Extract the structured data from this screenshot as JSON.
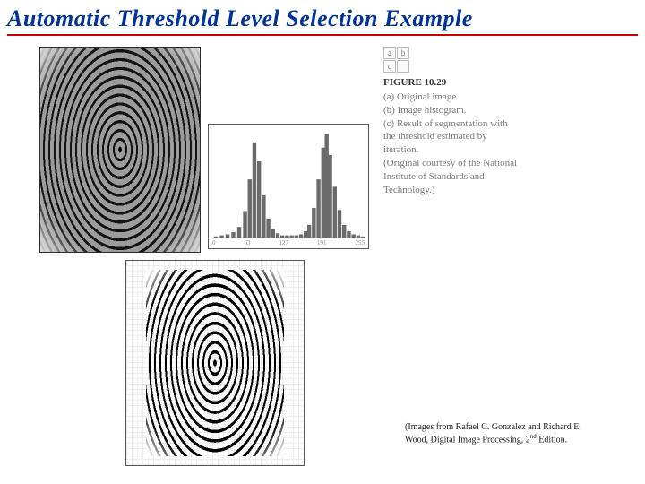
{
  "title": "Automatic Threshold Level Selection Example",
  "caption": {
    "grid": {
      "a": "a",
      "b": "b",
      "c": "c"
    },
    "figure_label": "FIGURE 10.29",
    "text_a": "(a) Original image.",
    "text_b": "(b) Image histogram.",
    "text_c": "(c) Result of segmentation with the threshold estimated by iteration.",
    "credit": "(Original courtesy of the National Institute of Standards and Technology.)"
  },
  "attribution": {
    "line1": "(Images from Rafael C. Gonzalez and Richard E.",
    "line2_pre": "Wood, Digital Image Processing, 2",
    "line2_sup": "nd",
    "line2_post": " Edition."
  },
  "chart_data": {
    "type": "bar",
    "title": "",
    "xlabel": "",
    "ylabel": "",
    "xlim": [
      0,
      255
    ],
    "ylim": [
      0,
      100
    ],
    "x_ticks": [
      0,
      63,
      127,
      191,
      255
    ],
    "description": "Bimodal grayscale image histogram with two prominent peaks (dark ridge pixels and light background pixels) separated by a deep valley around mid-gray, suitable for automatic threshold selection.",
    "series": [
      {
        "name": "histogram",
        "x": [
          0,
          10,
          20,
          30,
          40,
          50,
          58,
          66,
          74,
          82,
          90,
          98,
          106,
          114,
          122,
          130,
          138,
          146,
          154,
          160,
          168,
          176,
          184,
          190,
          196,
          204,
          212,
          220,
          228,
          236,
          244,
          252
        ],
        "values": [
          1,
          2,
          3,
          5,
          10,
          25,
          55,
          90,
          72,
          40,
          18,
          8,
          4,
          2,
          2,
          2,
          2,
          3,
          6,
          12,
          28,
          55,
          85,
          98,
          78,
          48,
          26,
          12,
          6,
          3,
          2,
          1
        ]
      }
    ]
  }
}
